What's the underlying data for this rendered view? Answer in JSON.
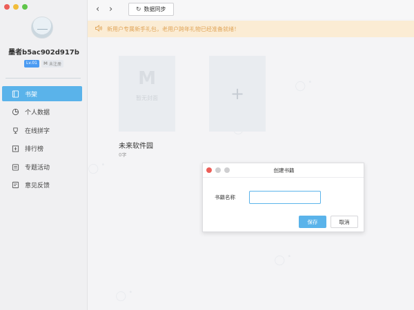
{
  "sidebar": {
    "username": "墨者b5ac902d917b",
    "level_badge": "Lv.01",
    "register_badge": "未注册",
    "items": [
      {
        "label": "书架",
        "icon": "bookshelf-icon"
      },
      {
        "label": "个人数据",
        "icon": "pie-chart-icon"
      },
      {
        "label": "在线拼字",
        "icon": "trophy-icon"
      },
      {
        "label": "排行榜",
        "icon": "ranking-icon"
      },
      {
        "label": "专题活动",
        "icon": "calendar-icon"
      },
      {
        "label": "意见反馈",
        "icon": "feedback-icon"
      }
    ],
    "active_index": 0
  },
  "toolbar": {
    "sync_label": "数据同步"
  },
  "notice": {
    "text": "新用户专属新手礼包，老用户跨年礼物已经准备就绪！"
  },
  "books": [
    {
      "cover_text": "暂无封面",
      "title": "未来软件园",
      "count": "0字"
    }
  ],
  "add_card_symbol": "+",
  "dialog": {
    "title": "创建书籍",
    "field_label": "书籍名称",
    "field_value": "",
    "save_label": "保存",
    "cancel_label": "取消"
  },
  "colors": {
    "accent": "#5ab3ea",
    "notice_bg": "#fbecd4",
    "notice_text": "#e0a559"
  }
}
